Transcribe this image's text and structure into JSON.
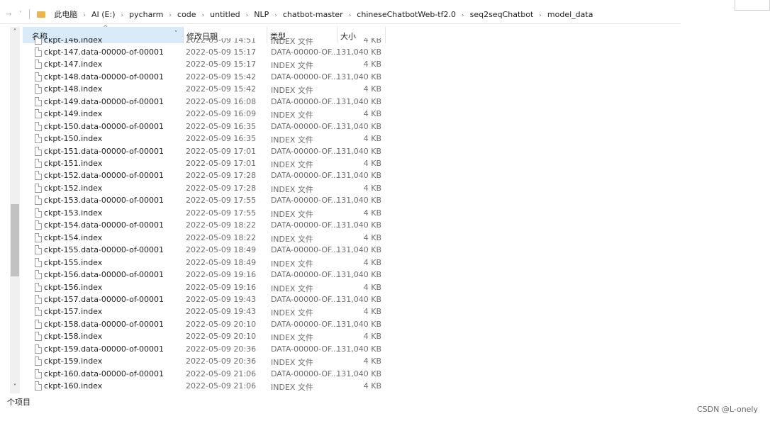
{
  "address_bar": {
    "crumbs": [
      "此电脑",
      "AI (E:)",
      "pycharm",
      "code",
      "untitled",
      "NLP",
      "chatbot-master",
      "chineseChatbotWeb-tf2.0",
      "seq2seqChatbot",
      "model_data"
    ]
  },
  "columns": {
    "name": "名称",
    "date": "修改日期",
    "type": "类型",
    "size": "大小"
  },
  "files": [
    {
      "name": "ckpt-146.index",
      "date": "2022-05-09 14:51",
      "type": "INDEX 文件",
      "size": "4 KB"
    },
    {
      "name": "ckpt-147.data-00000-of-00001",
      "date": "2022-05-09 15:17",
      "type": "DATA-00000-OF...",
      "size": "131,040 KB"
    },
    {
      "name": "ckpt-147.index",
      "date": "2022-05-09 15:17",
      "type": "INDEX 文件",
      "size": "4 KB"
    },
    {
      "name": "ckpt-148.data-00000-of-00001",
      "date": "2022-05-09 15:42",
      "type": "DATA-00000-OF...",
      "size": "131,040 KB"
    },
    {
      "name": "ckpt-148.index",
      "date": "2022-05-09 15:42",
      "type": "INDEX 文件",
      "size": "4 KB"
    },
    {
      "name": "ckpt-149.data-00000-of-00001",
      "date": "2022-05-09 16:08",
      "type": "DATA-00000-OF...",
      "size": "131,040 KB"
    },
    {
      "name": "ckpt-149.index",
      "date": "2022-05-09 16:09",
      "type": "INDEX 文件",
      "size": "4 KB"
    },
    {
      "name": "ckpt-150.data-00000-of-00001",
      "date": "2022-05-09 16:35",
      "type": "DATA-00000-OF...",
      "size": "131,040 KB"
    },
    {
      "name": "ckpt-150.index",
      "date": "2022-05-09 16:35",
      "type": "INDEX 文件",
      "size": "4 KB"
    },
    {
      "name": "ckpt-151.data-00000-of-00001",
      "date": "2022-05-09 17:01",
      "type": "DATA-00000-OF...",
      "size": "131,040 KB"
    },
    {
      "name": "ckpt-151.index",
      "date": "2022-05-09 17:01",
      "type": "INDEX 文件",
      "size": "4 KB"
    },
    {
      "name": "ckpt-152.data-00000-of-00001",
      "date": "2022-05-09 17:28",
      "type": "DATA-00000-OF...",
      "size": "131,040 KB"
    },
    {
      "name": "ckpt-152.index",
      "date": "2022-05-09 17:28",
      "type": "INDEX 文件",
      "size": "4 KB"
    },
    {
      "name": "ckpt-153.data-00000-of-00001",
      "date": "2022-05-09 17:55",
      "type": "DATA-00000-OF...",
      "size": "131,040 KB"
    },
    {
      "name": "ckpt-153.index",
      "date": "2022-05-09 17:55",
      "type": "INDEX 文件",
      "size": "4 KB"
    },
    {
      "name": "ckpt-154.data-00000-of-00001",
      "date": "2022-05-09 18:22",
      "type": "DATA-00000-OF...",
      "size": "131,040 KB"
    },
    {
      "name": "ckpt-154.index",
      "date": "2022-05-09 18:22",
      "type": "INDEX 文件",
      "size": "4 KB"
    },
    {
      "name": "ckpt-155.data-00000-of-00001",
      "date": "2022-05-09 18:49",
      "type": "DATA-00000-OF...",
      "size": "131,040 KB"
    },
    {
      "name": "ckpt-155.index",
      "date": "2022-05-09 18:49",
      "type": "INDEX 文件",
      "size": "4 KB"
    },
    {
      "name": "ckpt-156.data-00000-of-00001",
      "date": "2022-05-09 19:16",
      "type": "DATA-00000-OF...",
      "size": "131,040 KB"
    },
    {
      "name": "ckpt-156.index",
      "date": "2022-05-09 19:16",
      "type": "INDEX 文件",
      "size": "4 KB"
    },
    {
      "name": "ckpt-157.data-00000-of-00001",
      "date": "2022-05-09 19:43",
      "type": "DATA-00000-OF...",
      "size": "131,040 KB"
    },
    {
      "name": "ckpt-157.index",
      "date": "2022-05-09 19:43",
      "type": "INDEX 文件",
      "size": "4 KB"
    },
    {
      "name": "ckpt-158.data-00000-of-00001",
      "date": "2022-05-09 20:10",
      "type": "DATA-00000-OF...",
      "size": "131,040 KB"
    },
    {
      "name": "ckpt-158.index",
      "date": "2022-05-09 20:10",
      "type": "INDEX 文件",
      "size": "4 KB"
    },
    {
      "name": "ckpt-159.data-00000-of-00001",
      "date": "2022-05-09 20:36",
      "type": "DATA-00000-OF...",
      "size": "131,040 KB"
    },
    {
      "name": "ckpt-159.index",
      "date": "2022-05-09 20:36",
      "type": "INDEX 文件",
      "size": "4 KB"
    },
    {
      "name": "ckpt-160.data-00000-of-00001",
      "date": "2022-05-09 21:06",
      "type": "DATA-00000-OF...",
      "size": "131,040 KB"
    },
    {
      "name": "ckpt-160.index",
      "date": "2022-05-09 21:06",
      "type": "INDEX 文件",
      "size": "4 KB"
    }
  ],
  "status_bar": {
    "text": "个项目"
  },
  "watermark": "CSDN @L-onely",
  "icons": {
    "scroll_up": "scroll-up-icon",
    "scroll_down": "scroll-down-icon",
    "file": "file-icon",
    "folder": "folder-icon"
  },
  "colors": {
    "header_selected": "#d9ebf9",
    "folder": "#e8b64a",
    "secondary_text": "#6d6d6d"
  }
}
